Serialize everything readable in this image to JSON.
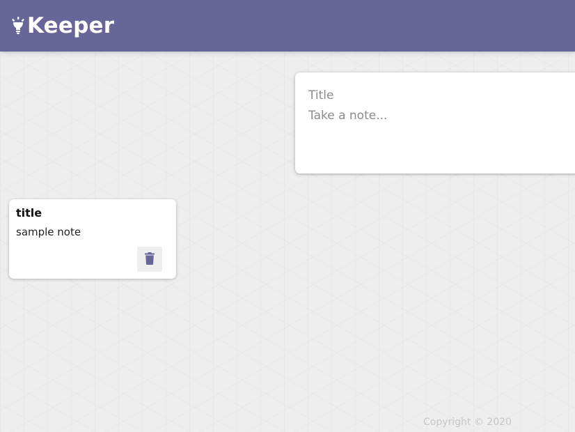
{
  "header": {
    "brand": "Keeper",
    "logo_icon": "lightbulb-icon",
    "background_color": "#686599"
  },
  "create_note": {
    "title_placeholder": "Title",
    "content_placeholder": "Take a note...",
    "title_value": "",
    "content_value": ""
  },
  "notes": [
    {
      "title": "title",
      "content": "sample note",
      "delete_icon": "trash-icon"
    }
  ],
  "footer": {
    "copyright": "Copyright © 2020"
  }
}
